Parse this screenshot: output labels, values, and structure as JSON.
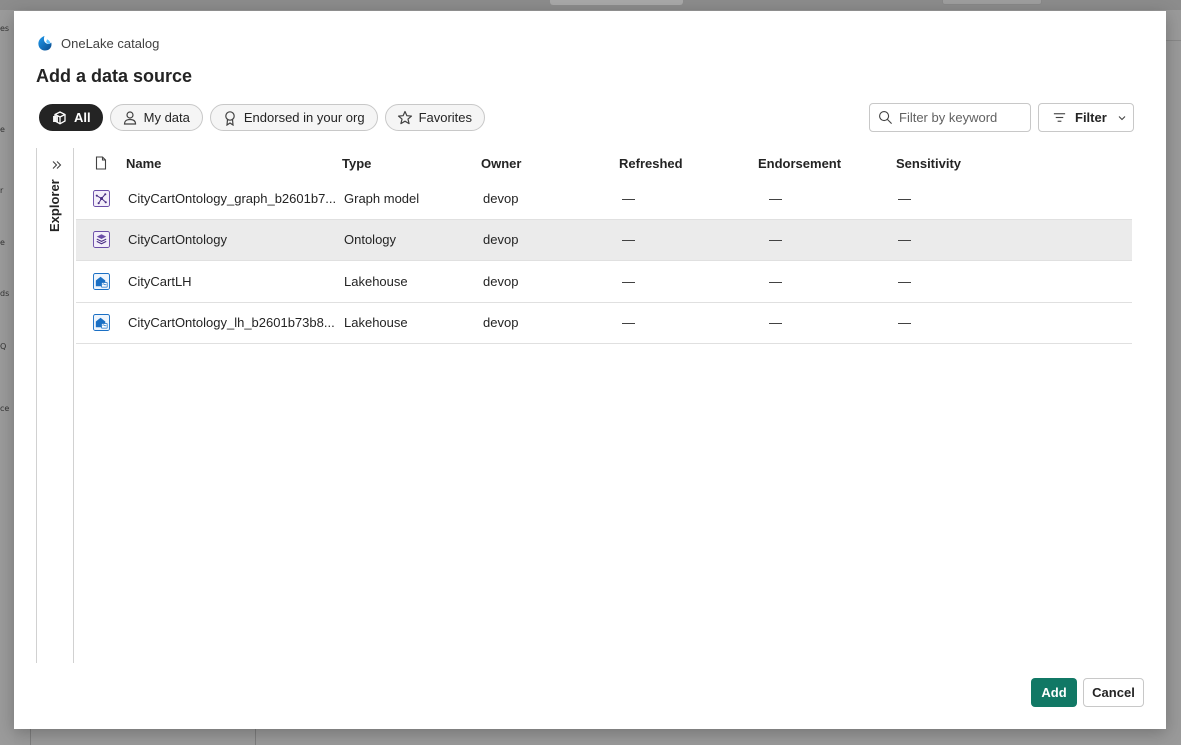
{
  "backdrop": {
    "left_fragments": [
      "es",
      "e",
      "r",
      "e",
      "ds",
      "Q",
      "ce"
    ]
  },
  "catalog": {
    "name": "OneLake catalog",
    "logo_icon": "onelake-icon"
  },
  "dialog": {
    "title": "Add a data source"
  },
  "chips": [
    {
      "label": "All",
      "icon": "cube-icon",
      "active": true
    },
    {
      "label": "My data",
      "icon": "person-icon",
      "active": false
    },
    {
      "label": "Endorsed in your org",
      "icon": "ribbon-icon",
      "active": false
    },
    {
      "label": "Favorites",
      "icon": "star-icon",
      "active": false
    }
  ],
  "search": {
    "placeholder": "Filter by keyword",
    "value": ""
  },
  "filter": {
    "label": "Filter"
  },
  "explorer": {
    "label": "Explorer"
  },
  "table": {
    "columns": [
      "Name",
      "Type",
      "Owner",
      "Refreshed",
      "Endorsement",
      "Sensitivity"
    ],
    "rows": [
      {
        "icon": "graph-model-icon",
        "name": "CityCartOntology_graph_b2601b7...",
        "type": "Graph model",
        "owner": "devop",
        "refreshed": "—",
        "endorsement": "—",
        "sensitivity": "—",
        "selected": false
      },
      {
        "icon": "ontology-icon",
        "name": "CityCartOntology",
        "type": "Ontology",
        "owner": "devop",
        "refreshed": "—",
        "endorsement": "—",
        "sensitivity": "—",
        "selected": true
      },
      {
        "icon": "lakehouse-icon",
        "name": "CityCartLH",
        "type": "Lakehouse",
        "owner": "devop",
        "refreshed": "—",
        "endorsement": "—",
        "sensitivity": "—",
        "selected": false
      },
      {
        "icon": "lakehouse-icon",
        "name": "CityCartOntology_lh_b2601b73b8...",
        "type": "Lakehouse",
        "owner": "devop",
        "refreshed": "—",
        "endorsement": "—",
        "sensitivity": "—",
        "selected": false
      }
    ]
  },
  "footer": {
    "add_label": "Add",
    "cancel_label": "Cancel"
  },
  "colors": {
    "primary": "#117865",
    "selected_row": "#ebebeb",
    "active_chip": "#242424"
  }
}
